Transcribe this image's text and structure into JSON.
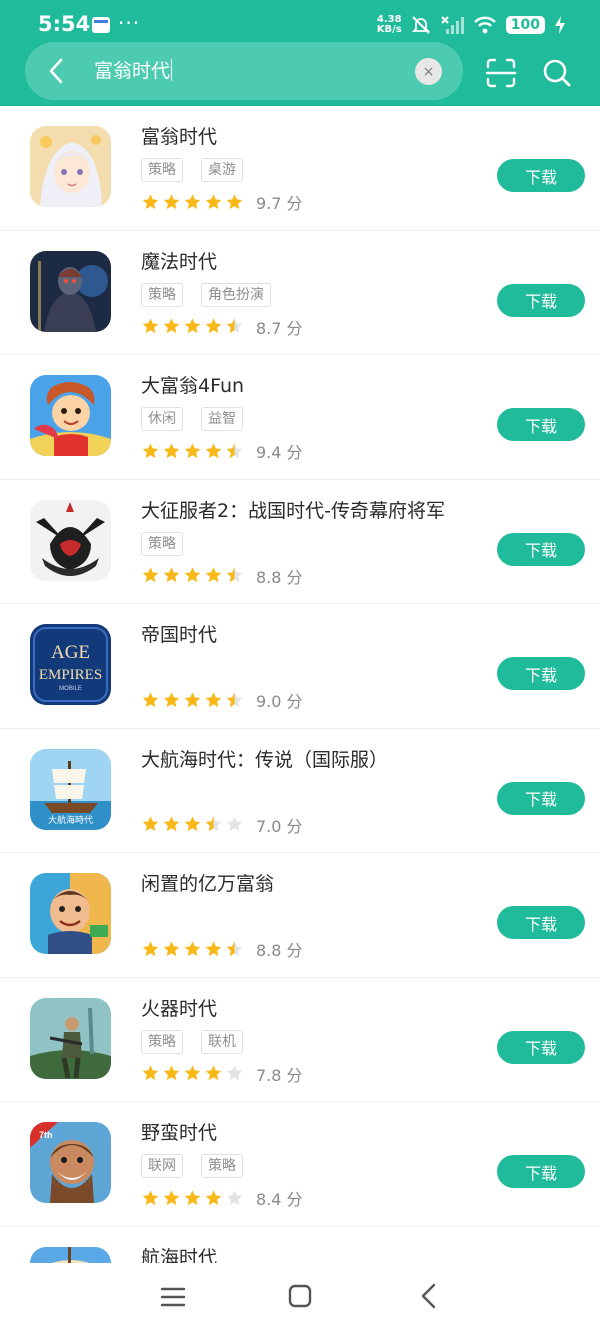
{
  "status": {
    "time": "5:54",
    "dots": "···",
    "net_speed": "4.38",
    "net_unit": "KB/s",
    "battery": "100"
  },
  "search": {
    "query": "富翁时代",
    "clear_symbol": "×"
  },
  "download_label": "下载",
  "apps": [
    {
      "name": "富翁时代",
      "tags": [
        "策略",
        "桌游"
      ],
      "rating": 5,
      "score": "9.7 分",
      "icon": "anime-girl-icon"
    },
    {
      "name": "魔法时代",
      "tags": [
        "策略",
        "角色扮演"
      ],
      "rating": 4.5,
      "score": "8.7 分",
      "icon": "dark-warrior-icon"
    },
    {
      "name": "大富翁4Fun",
      "tags": [
        "休闲",
        "益智"
      ],
      "rating": 4.5,
      "score": "9.4 分",
      "icon": "cartoon-boy-icon"
    },
    {
      "name": "大征服者2：战国时代-传奇幕府将军",
      "tags": [
        "策略"
      ],
      "rating": 4.5,
      "score": "8.8 分",
      "icon": "samurai-helmet-icon"
    },
    {
      "name": "帝国时代",
      "tags": [],
      "rating": 4.5,
      "score": "9.0 分",
      "icon": "age-of-empires-logo-icon",
      "logo_lines": [
        "AGE",
        "EMPIRES",
        "MOBILE"
      ]
    },
    {
      "name": "大航海时代：传说（国际服）",
      "tags": [],
      "rating": 3.5,
      "score": "7.0 分",
      "icon": "sailing-ship-icon",
      "logo_lines": [
        "大航海時代"
      ]
    },
    {
      "name": "闲置的亿万富翁",
      "tags": [],
      "rating": 4.5,
      "score": "8.8 分",
      "icon": "money-man-icon"
    },
    {
      "name": "火器时代",
      "tags": [
        "策略",
        "联机"
      ],
      "rating": 4,
      "score": "7.8 分",
      "icon": "soldier-icon"
    },
    {
      "name": "野蛮时代",
      "tags": [
        "联网",
        "策略"
      ],
      "rating": 4,
      "score": "8.4 分",
      "icon": "barbarian-icon",
      "logo_lines": [
        "7th"
      ]
    },
    {
      "name": "航海时代",
      "tags": [],
      "rating": 0,
      "score": "",
      "icon": "ship-partial-icon"
    }
  ],
  "colors": {
    "accent": "#1fbb9b",
    "star": "#f7b818",
    "star_empty": "#e3e3e3"
  }
}
